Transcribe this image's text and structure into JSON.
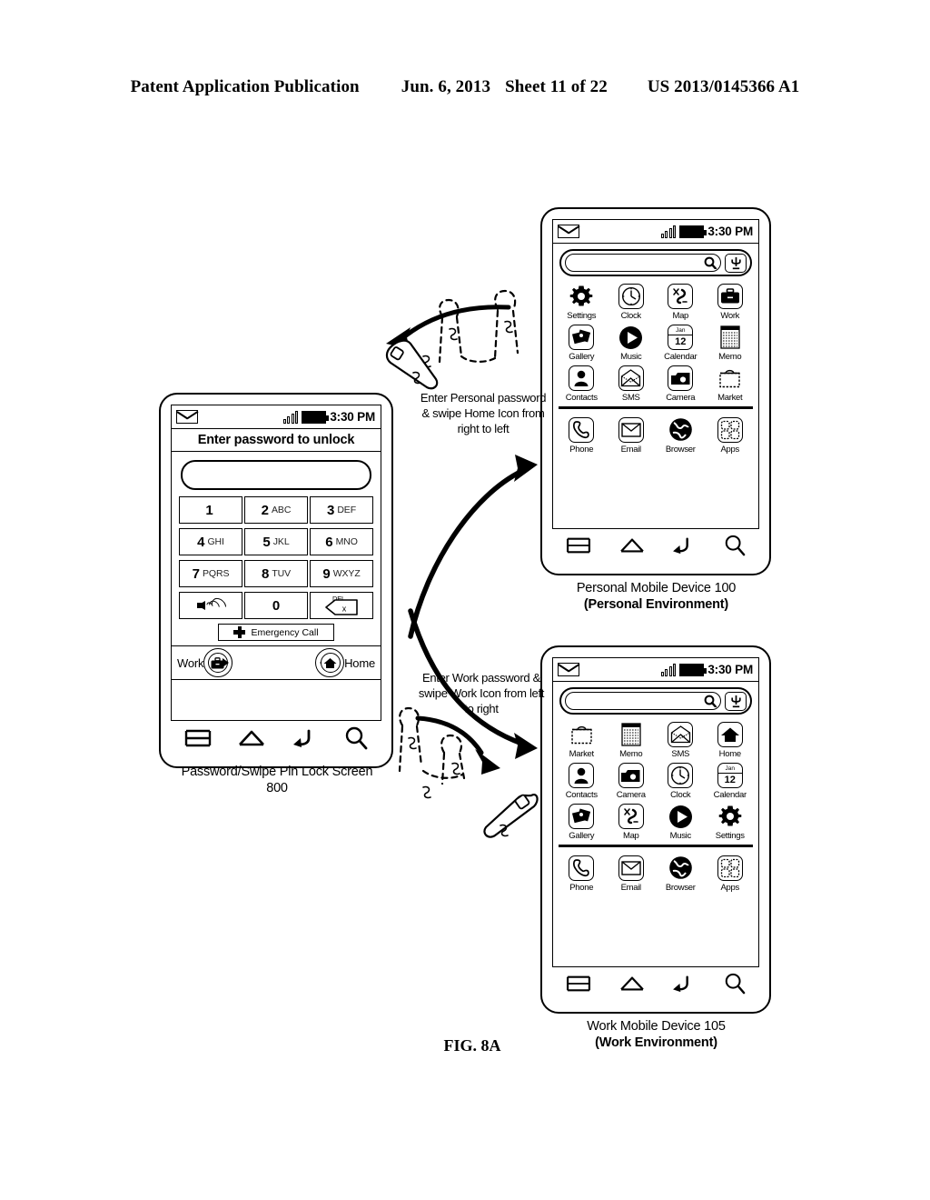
{
  "header": {
    "publication": "Patent Application Publication",
    "date": "Jun. 6, 2013",
    "sheet": "Sheet 11 of 22",
    "number": "US 2013/0145366 A1"
  },
  "figure_label": "FIG. 8A",
  "lock_screen": {
    "status_bar": {
      "time": "3:30 PM",
      "mail_icon": "envelope-icon",
      "signal_icon": "signal-bars-icon",
      "battery_icon": "battery-icon"
    },
    "title": "Enter password to unlock",
    "password_value": "",
    "keys": [
      [
        {
          "digit": "1",
          "letters": ""
        },
        {
          "digit": "2",
          "letters": "ABC"
        },
        {
          "digit": "3",
          "letters": "DEF"
        }
      ],
      [
        {
          "digit": "4",
          "letters": "GHI"
        },
        {
          "digit": "5",
          "letters": "JKL"
        },
        {
          "digit": "6",
          "letters": "MNO"
        }
      ],
      [
        {
          "digit": "7",
          "letters": "PQRS"
        },
        {
          "digit": "8",
          "letters": "TUV"
        },
        {
          "digit": "9",
          "letters": "WXYZ"
        }
      ]
    ],
    "speaker_key": "speaker-icon",
    "zero_key": "0",
    "delete_key": {
      "label": "DEL",
      "glyph": "x"
    },
    "emergency_call": "Emergency Call",
    "swipe_work_label": "Work",
    "swipe_home_label": "Home",
    "nav": [
      "menu-icon",
      "home-icon",
      "back-icon",
      "search-icon"
    ],
    "caption_line1": "Password/Swipe Pin Lock Screen",
    "caption_line2": "800"
  },
  "personal_device": {
    "status_bar": {
      "time": "3:30 PM"
    },
    "search": {
      "value": "",
      "search_icon": "search-icon",
      "mic_icon": "microphone-icon"
    },
    "grid": [
      [
        {
          "label": "Settings",
          "icon": "gear-icon"
        },
        {
          "label": "Clock",
          "icon": "clock-icon"
        },
        {
          "label": "Map",
          "icon": "map-icon"
        },
        {
          "label": "Work",
          "icon": "briefcase-icon"
        }
      ],
      [
        {
          "label": "Gallery",
          "icon": "gallery-icon"
        },
        {
          "label": "Music",
          "icon": "play-icon"
        },
        {
          "label": "Calendar",
          "icon": "calendar-icon"
        },
        {
          "label": "Memo",
          "icon": "memo-icon"
        }
      ],
      [
        {
          "label": "Contacts",
          "icon": "contact-icon"
        },
        {
          "label": "SMS",
          "icon": "open-envelope-icon"
        },
        {
          "label": "Camera",
          "icon": "camera-icon"
        },
        {
          "label": "Market",
          "icon": "bag-icon"
        }
      ]
    ],
    "dock": [
      {
        "label": "Phone",
        "icon": "handset-icon"
      },
      {
        "label": "Email",
        "icon": "envelope-icon"
      },
      {
        "label": "Browser",
        "icon": "globe-icon"
      },
      {
        "label": "Apps",
        "icon": "apps-grid-icon"
      }
    ],
    "calendar_month": "Jan",
    "calendar_day": "12",
    "nav": [
      "menu-icon",
      "home-icon",
      "back-icon",
      "search-icon"
    ],
    "caption_line1": "Personal Mobile Device 100",
    "caption_line2": "(Personal Environment)"
  },
  "work_device": {
    "status_bar": {
      "time": "3:30 PM"
    },
    "search": {
      "value": "",
      "search_icon": "search-icon",
      "mic_icon": "microphone-icon"
    },
    "grid": [
      [
        {
          "label": "Market",
          "icon": "bag-icon"
        },
        {
          "label": "Memo",
          "icon": "memo-icon"
        },
        {
          "label": "SMS",
          "icon": "open-envelope-icon"
        },
        {
          "label": "Home",
          "icon": "house-icon"
        }
      ],
      [
        {
          "label": "Contacts",
          "icon": "contact-icon"
        },
        {
          "label": "Camera",
          "icon": "camera-icon"
        },
        {
          "label": "Clock",
          "icon": "clock-icon"
        },
        {
          "label": "Calendar",
          "icon": "calendar-icon"
        }
      ],
      [
        {
          "label": "Gallery",
          "icon": "gallery-icon"
        },
        {
          "label": "Map",
          "icon": "map-icon"
        },
        {
          "label": "Music",
          "icon": "play-icon"
        },
        {
          "label": "Settings",
          "icon": "gear-icon"
        }
      ]
    ],
    "dock": [
      {
        "label": "Phone",
        "icon": "handset-icon"
      },
      {
        "label": "Email",
        "icon": "envelope-icon"
      },
      {
        "label": "Browser",
        "icon": "globe-icon"
      },
      {
        "label": "Apps",
        "icon": "apps-grid-icon"
      }
    ],
    "calendar_month": "Jan",
    "calendar_day": "12",
    "nav": [
      "menu-icon",
      "home-icon",
      "back-icon",
      "search-icon"
    ],
    "caption_line1": "Work Mobile Device 105",
    "caption_line2": "(Work Environment)"
  },
  "annotations": {
    "personal": "Enter Personal password & swipe Home Icon from right to left",
    "work": "Enter Work password & swipe Work Icon from left to right"
  }
}
